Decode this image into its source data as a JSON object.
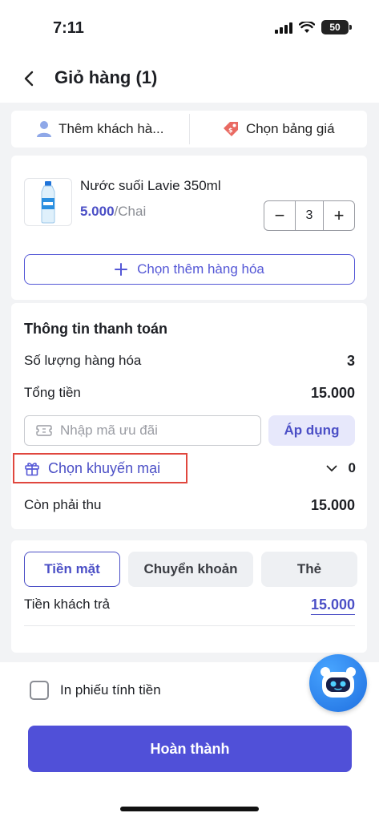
{
  "status_bar": {
    "time": "7:11",
    "battery": "50"
  },
  "header": {
    "title": "Giỏ hàng (1)"
  },
  "customer_bar": {
    "add_customer": "Thêm khách hà...",
    "price_list": "Chọn bảng giá"
  },
  "cart": {
    "item": {
      "name": "Nước suối Lavie 350ml",
      "price": "5.000",
      "unit": "/Chai",
      "quantity": "3",
      "minus": "−",
      "plus": "+"
    },
    "add_more_label": "Chọn thêm hàng hóa"
  },
  "payment": {
    "title": "Thông tin thanh toán",
    "qty_label": "Số lượng hàng hóa",
    "qty_value": "3",
    "total_label": "Tổng tiền",
    "total_value": "15.000",
    "promo_placeholder": "Nhập mã ưu đãi",
    "apply_label": "Áp dụng",
    "promo_select_label": "Chọn khuyến mại",
    "promo_count": "0",
    "remaining_label": "Còn phải thu",
    "remaining_value": "15.000"
  },
  "methods": {
    "tabs": [
      "Tiền mặt",
      "Chuyển khoản",
      "Thẻ"
    ],
    "customer_pays_label": "Tiền khách trả",
    "customer_pays_value": "15.000"
  },
  "footer": {
    "print_label": "In phiếu tính tiền",
    "done_label": "Hoàn thành"
  },
  "colors": {
    "accent": "#5050d8",
    "highlight": "#e0473e",
    "background": "#f2f3f5"
  }
}
